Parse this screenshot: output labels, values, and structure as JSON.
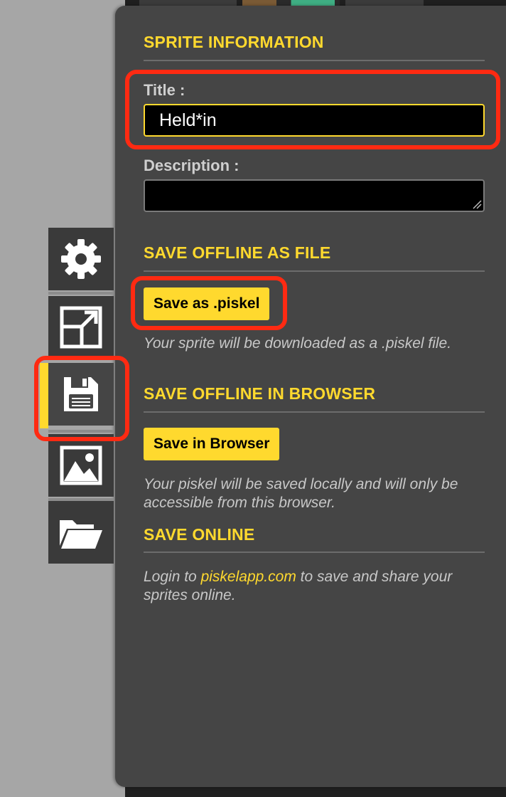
{
  "sections": {
    "sprite_info": "SPRITE INFORMATION",
    "save_file": "SAVE OFFLINE AS FILE",
    "save_browser": "SAVE OFFLINE IN BROWSER",
    "save_online": "SAVE ONLINE"
  },
  "fields": {
    "title_label": "Title :",
    "title_value": "Held*in",
    "description_label": "Description :",
    "description_value": ""
  },
  "buttons": {
    "save_piskel": "Save as .piskel",
    "save_browser": "Save in Browser"
  },
  "help": {
    "file": "Your sprite will be downloaded as a .piskel file.",
    "browser": "Your piskel will be saved locally and will only be accessible from this browser.",
    "online_prefix": "Login to ",
    "online_link": "piskelapp.com",
    "online_suffix": " to save and share your sprites online."
  },
  "side_tabs": [
    {
      "icon": "gear-icon"
    },
    {
      "icon": "resize-icon"
    },
    {
      "icon": "floppy-disk-icon",
      "active": true
    },
    {
      "icon": "image-icon"
    },
    {
      "icon": "folder-open-icon"
    }
  ],
  "colors": {
    "accent": "#ffd92e",
    "highlight": "#ff2a12",
    "panel": "#454545",
    "tab": "#3a3a3a"
  }
}
